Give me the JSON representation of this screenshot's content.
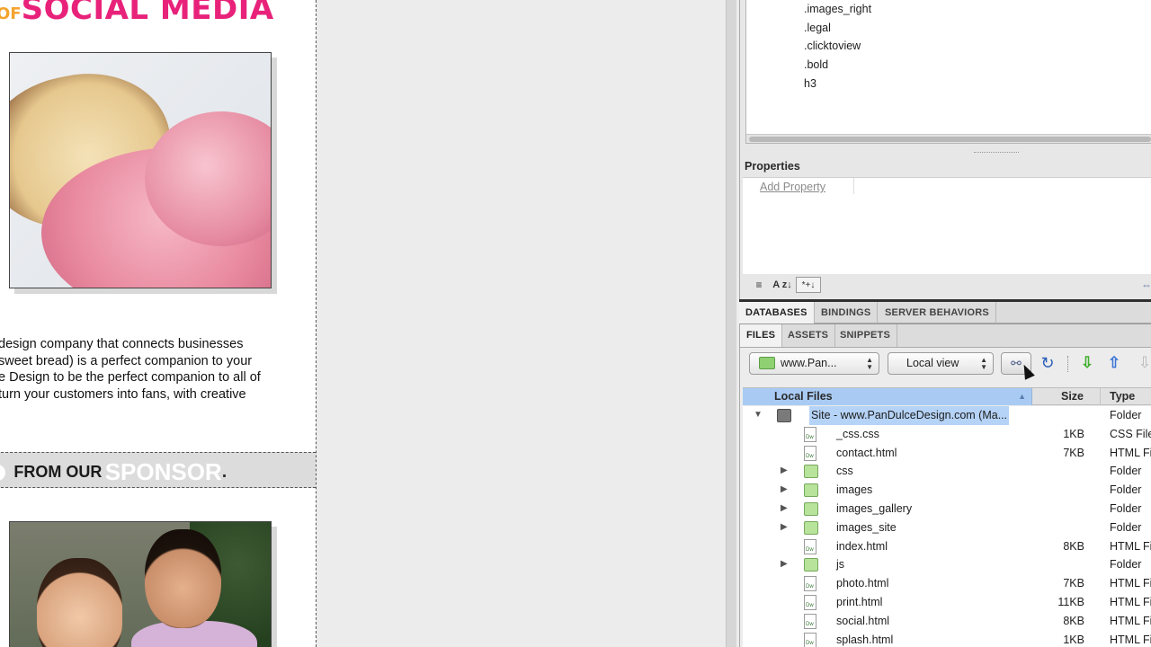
{
  "design": {
    "brand": {
      "prefix": "OF",
      "title": "SOCIAL MEDIA"
    },
    "intro_lines": [
      "design company that connects businesses",
      "sweet bread) is a perfect companion to your",
      "e Design to be the perfect companion to all of",
      " turn your customers into fans, with creative"
    ],
    "sponsor": {
      "from": "FROM OUR",
      "sponsor": "SPONSOR",
      "dot": "."
    }
  },
  "css_panel": {
    "rules": [
      ".images_right",
      ".legal",
      ".clicktoview",
      ".bold",
      "h3"
    ],
    "properties_title": "Properties",
    "add_property": "Add Property",
    "toolbar": {
      "category": "≡",
      "alpha": "A z↓",
      "set": "*+↓",
      "link": "⇔"
    }
  },
  "db_group": {
    "tabs": [
      "DATABASES",
      "BINDINGS",
      "SERVER BEHAVIORS"
    ],
    "active": "DATABASES"
  },
  "files_panel": {
    "tabs": [
      "FILES",
      "ASSETS",
      "SNIPPETS"
    ],
    "active": "FILES",
    "site_select": "www.Pan...",
    "view_select": "Local view",
    "icons": {
      "connect": "plug-icon",
      "refresh": "refresh-icon",
      "get": "get-down-arrow-icon",
      "put": "put-up-arrow-icon",
      "check_out": "check-out-icon"
    },
    "buttons": {
      "connect": "⚯",
      "refresh": "↻",
      "get": "⇩",
      "put": "⇧",
      "check_out": "⇩"
    },
    "columns": {
      "name": "Local Files",
      "size": "Size",
      "type": "Type",
      "sort": "▲"
    },
    "rows": [
      {
        "name": "Site - www.PanDulceDesign.com (Ma...",
        "size": "",
        "type": "Folder",
        "kind": "site",
        "expanded": true,
        "disc": "▼"
      },
      {
        "name": "_css.css",
        "size": "1KB",
        "type": "CSS File",
        "kind": "file",
        "disc": ""
      },
      {
        "name": "contact.html",
        "size": "7KB",
        "type": "HTML Fi",
        "kind": "file",
        "disc": ""
      },
      {
        "name": "css",
        "size": "",
        "type": "Folder",
        "kind": "folder",
        "disc": "▶"
      },
      {
        "name": "images",
        "size": "",
        "type": "Folder",
        "kind": "folder",
        "disc": "▶"
      },
      {
        "name": "images_gallery",
        "size": "",
        "type": "Folder",
        "kind": "folder",
        "disc": "▶"
      },
      {
        "name": "images_site",
        "size": "",
        "type": "Folder",
        "kind": "folder",
        "disc": "▶"
      },
      {
        "name": "index.html",
        "size": "8KB",
        "type": "HTML Fi",
        "kind": "file",
        "disc": ""
      },
      {
        "name": "js",
        "size": "",
        "type": "Folder",
        "kind": "folder",
        "disc": "▶"
      },
      {
        "name": "photo.html",
        "size": "7KB",
        "type": "HTML Fi",
        "kind": "file",
        "disc": ""
      },
      {
        "name": "print.html",
        "size": "11KB",
        "type": "HTML Fi",
        "kind": "file",
        "disc": ""
      },
      {
        "name": "social.html",
        "size": "8KB",
        "type": "HTML Fi",
        "kind": "file",
        "disc": ""
      },
      {
        "name": "splash.html",
        "size": "1KB",
        "type": "HTML Fi",
        "kind": "file",
        "disc": ""
      }
    ]
  }
}
